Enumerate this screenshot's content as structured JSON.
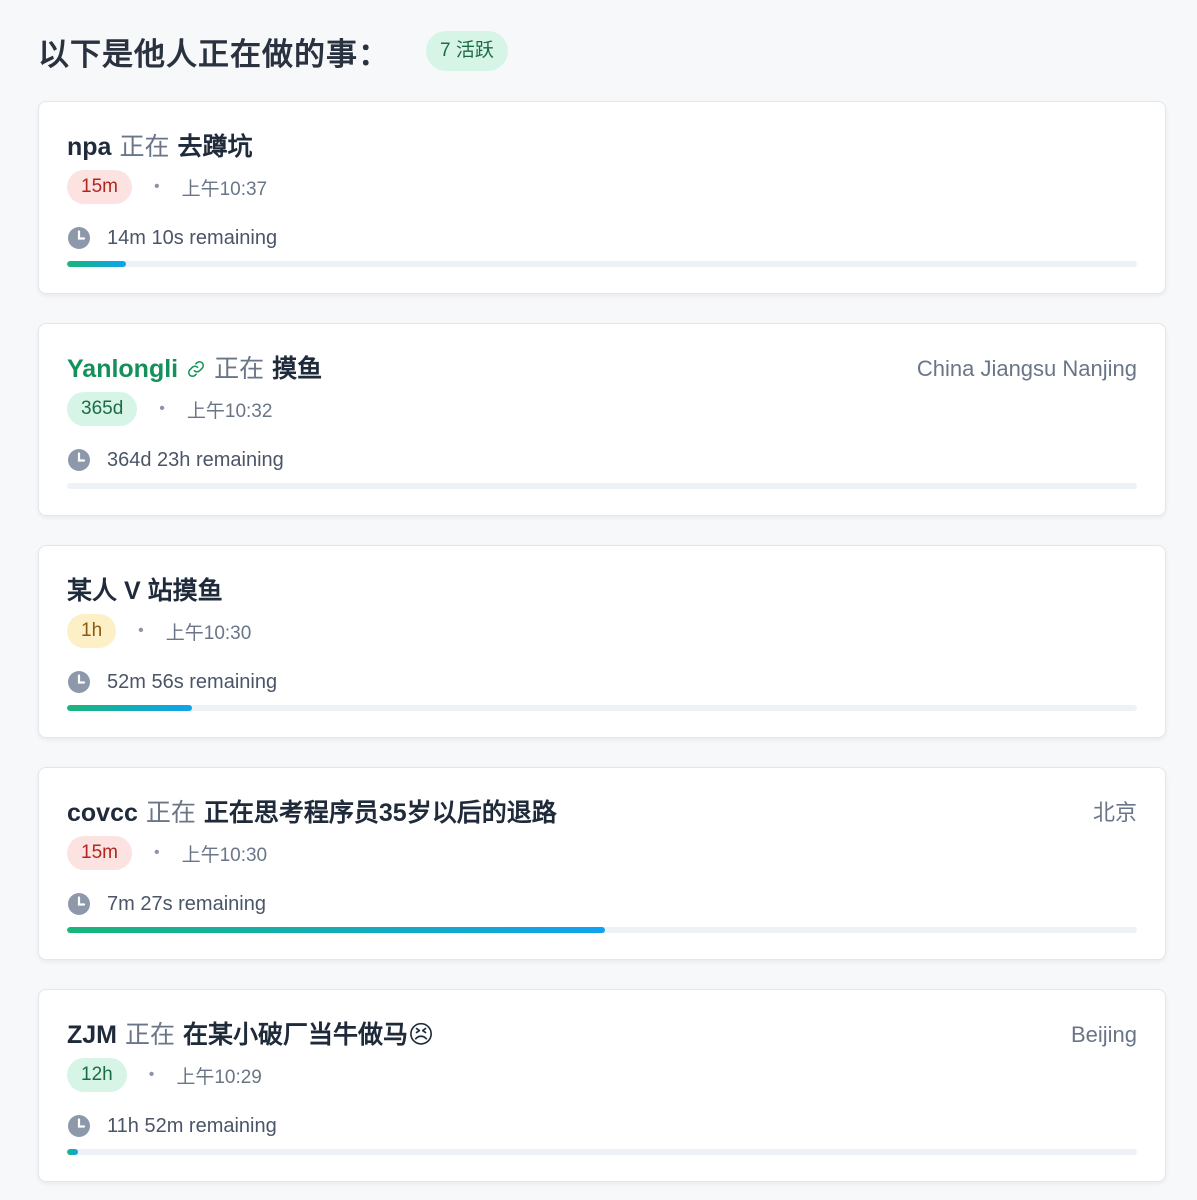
{
  "header": {
    "title": "以下是他人正在做的事：",
    "active_badge": "7 活跃"
  },
  "cards": [
    {
      "user": "npa",
      "verb": "正在",
      "activity": "去蹲坑",
      "location": "",
      "duration": "15m",
      "duration_color": "red",
      "time": "上午10:37",
      "remaining": "14m 10s remaining",
      "progress": 0.055
    },
    {
      "user": "Yanlongli",
      "has_link": true,
      "verb": "正在",
      "activity": "摸鱼",
      "location": "China Jiangsu Nanjing",
      "duration": "365d",
      "duration_color": "green",
      "time": "上午10:32",
      "remaining": "364d 23h remaining",
      "progress": 0.0
    },
    {
      "user": "",
      "verb": "",
      "activity": "某人 V 站摸鱼",
      "location": "",
      "duration": "1h",
      "duration_color": "yellow",
      "time": "上午10:30",
      "remaining": "52m 56s remaining",
      "progress": 0.117
    },
    {
      "user": "covcc",
      "verb": "正在",
      "activity": "正在思考程序员35岁以后的退路",
      "location": "北京",
      "duration": "15m",
      "duration_color": "red",
      "time": "上午10:30",
      "remaining": "7m 27s remaining",
      "progress": 0.503
    },
    {
      "user": "ZJM",
      "verb": "正在",
      "activity": "在某小破厂当牛做马😣",
      "location": "Beijing",
      "duration": "12h",
      "duration_color": "green",
      "time": "上午10:29",
      "remaining": "11h 52m remaining",
      "progress": 0.01
    }
  ],
  "colors": {
    "progress_start": "#18b67a",
    "progress_end": "#0fa3f0",
    "link_user": "#15905b"
  },
  "icons": {
    "clock": "clock-icon",
    "link": "link-icon"
  }
}
